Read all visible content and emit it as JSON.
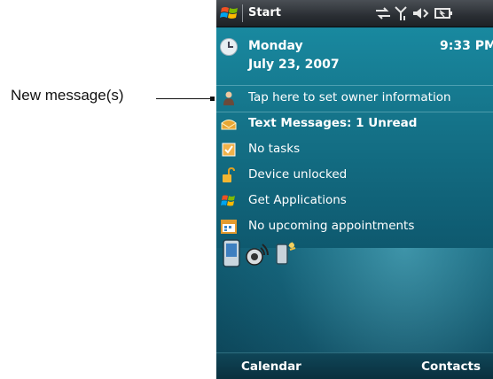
{
  "callout": {
    "label": "New message(s)"
  },
  "titlebar": {
    "start_label": "Start"
  },
  "today": {
    "day": "Monday",
    "date": "July 23, 2007",
    "time": "9:33 PM"
  },
  "items": [
    {
      "label": "Tap here to set owner information",
      "icon": "owner-icon",
      "bold": false
    },
    {
      "label": "Text Messages: 1 Unread",
      "icon": "message-icon",
      "bold": true
    },
    {
      "label": "No tasks",
      "icon": "tasks-icon",
      "bold": false
    },
    {
      "label": "Device unlocked",
      "icon": "unlocked-padlock-icon",
      "bold": false
    },
    {
      "label": "Get Applications",
      "icon": "windows-flag-icon",
      "bold": false
    },
    {
      "label": "No upcoming appointments",
      "icon": "calendar-icon",
      "bold": false
    }
  ],
  "launcher_icons": [
    "phone-icon",
    "wireless-icon",
    "device-comm-icon"
  ],
  "softkeys": {
    "left": "Calendar",
    "right": "Contacts"
  },
  "colors": {
    "screen_top": "#1a8fa6",
    "screen_bottom": "#0b3f52",
    "titlebar": "#2a2e33",
    "text": "#ffffff"
  }
}
